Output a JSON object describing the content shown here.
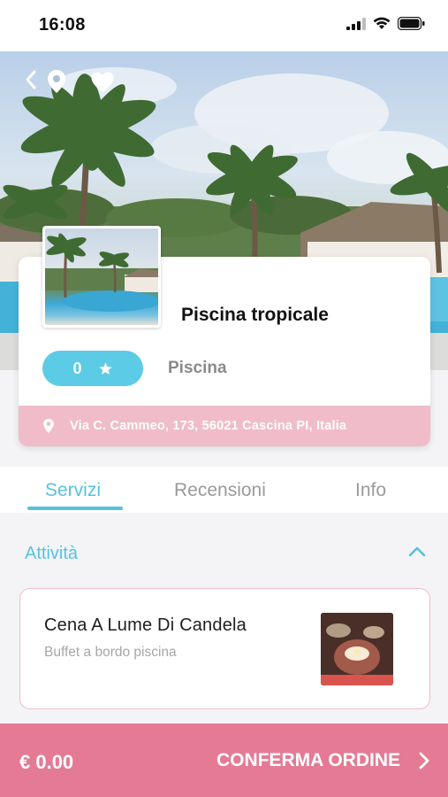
{
  "status_bar": {
    "time": "16:08"
  },
  "place": {
    "name": "Piscina tropicale",
    "rating": "0",
    "category": "Piscina",
    "address": "Via C. Cammeo, 173, 56021 Cascina PI, Italia"
  },
  "tabs": [
    {
      "label": "Servizi",
      "active": true
    },
    {
      "label": "Recensioni",
      "active": false
    },
    {
      "label": "Info",
      "active": false
    }
  ],
  "section": {
    "title": "Attività"
  },
  "activity": {
    "title": "Cena A Lume Di Candela",
    "subtitle": "Buffet a bordo piscina"
  },
  "footer": {
    "total": "€ 0.00",
    "confirm_label": "CONFERMA ORDINE"
  },
  "colors": {
    "accent_blue": "#55c2e0",
    "accent_pink": "#e57a94",
    "address_pink": "#f0bcc9"
  },
  "icons": [
    "back-icon",
    "location-pin-icon",
    "heart-icon",
    "star-icon",
    "chevron-up-icon",
    "chevron-right-icon",
    "signal-icon",
    "wifi-icon",
    "battery-icon"
  ]
}
